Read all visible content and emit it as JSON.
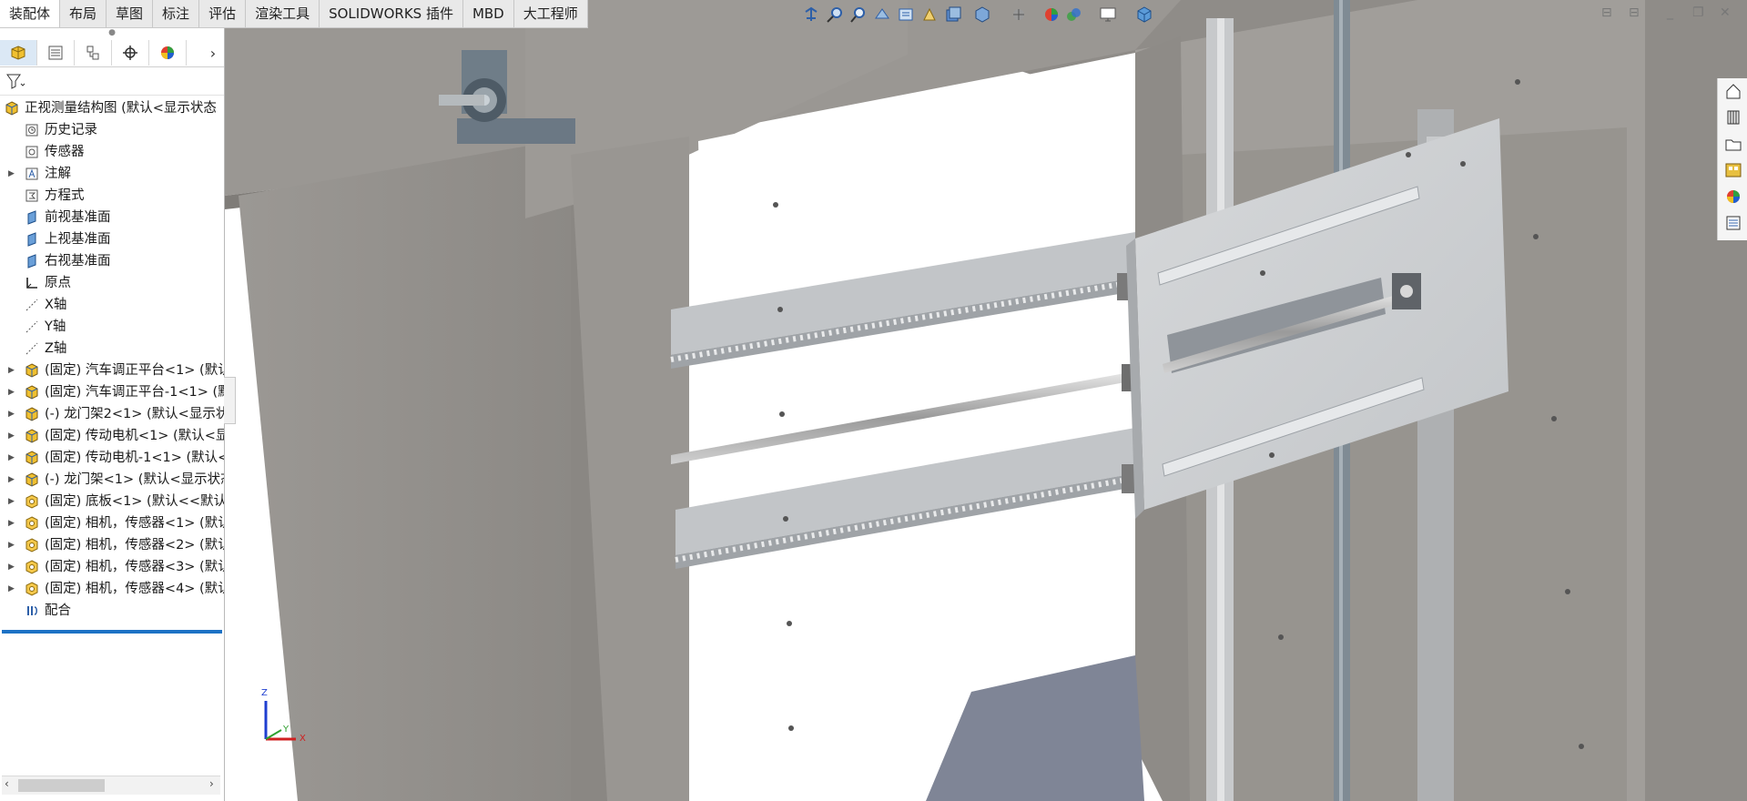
{
  "command_tabs": [
    "装配体",
    "布局",
    "草图",
    "标注",
    "评估",
    "渲染工具",
    "SOLIDWORKS 插件",
    "MBD",
    "大工程师"
  ],
  "active_tab_index": 0,
  "colors": {
    "accent": "#1d72c5",
    "panel_bg": "#ffffff",
    "tab_bar_bg": "#e9e9e9",
    "model_gray": "#9c9995",
    "plate_light": "#cfd2d5",
    "rail_gray": "#b7babd"
  },
  "panel_tabs": [
    "featuremanager-icon",
    "propertymanager-icon",
    "configurationmanager-icon",
    "dimxpert-icon",
    "displaymanager-icon"
  ],
  "tree": {
    "root": "正视测量结构图 (默认<显示状态",
    "items": [
      {
        "label": "历史记录",
        "icon": "history-icon",
        "expand": false
      },
      {
        "label": "传感器",
        "icon": "sensor-icon",
        "expand": false
      },
      {
        "label": "注解",
        "icon": "annotation-icon",
        "expand": true
      },
      {
        "label": "方程式",
        "icon": "equation-icon",
        "expand": false
      },
      {
        "label": "前视基准面",
        "icon": "plane-icon",
        "expand": false
      },
      {
        "label": "上视基准面",
        "icon": "plane-icon",
        "expand": false
      },
      {
        "label": "右视基准面",
        "icon": "plane-icon",
        "expand": false
      },
      {
        "label": "原点",
        "icon": "origin-icon",
        "expand": false
      },
      {
        "label": "X轴",
        "icon": "axis-icon",
        "expand": false
      },
      {
        "label": "Y轴",
        "icon": "axis-icon",
        "expand": false
      },
      {
        "label": "Z轴",
        "icon": "axis-icon",
        "expand": false
      },
      {
        "label": "(固定) 汽车调正平台<1> (默认",
        "icon": "assembly-icon",
        "expand": true
      },
      {
        "label": "(固定) 汽车调正平台-1<1> (默",
        "icon": "assembly-icon",
        "expand": true
      },
      {
        "label": "(-) 龙门架2<1> (默认<显示状",
        "icon": "assembly-icon",
        "expand": true
      },
      {
        "label": "(固定) 传动电机<1> (默认<显",
        "icon": "assembly-icon",
        "expand": true
      },
      {
        "label": "(固定) 传动电机-1<1> (默认<",
        "icon": "assembly-icon",
        "expand": true
      },
      {
        "label": "(-) 龙门架<1> (默认<显示状态",
        "icon": "assembly-icon",
        "expand": true
      },
      {
        "label": "(固定) 底板<1> (默认<<默认",
        "icon": "part-icon",
        "expand": true
      },
      {
        "label": "(固定) 相机，传感器<1> (默认",
        "icon": "part-icon",
        "expand": true
      },
      {
        "label": "(固定) 相机，传感器<2> (默认",
        "icon": "part-icon",
        "expand": true
      },
      {
        "label": "(固定) 相机，传感器<3> (默认",
        "icon": "part-icon",
        "expand": true
      },
      {
        "label": "(固定) 相机，传感器<4> (默认",
        "icon": "part-icon",
        "expand": true
      },
      {
        "label": "配合",
        "icon": "mates-icon",
        "expand": false
      }
    ]
  },
  "triad": {
    "z": "Z",
    "y": "Y",
    "x": "X"
  },
  "heads_up_toolbar": [
    "zoom-to-fit-icon",
    "zoom-to-area-icon",
    "previous-view-icon",
    "section-view-icon",
    "dynamic-annotation-icon",
    "view-orientation-icon",
    "display-style-icon",
    "hide-show-icon",
    "edit-appearance-icon",
    "apply-scene-icon",
    "view-settings-icon",
    "display-icon"
  ],
  "task_pane": [
    "home-icon",
    "design-library-icon",
    "file-explorer-icon",
    "view-palette-icon",
    "appearances-icon",
    "custom-properties-icon"
  ]
}
